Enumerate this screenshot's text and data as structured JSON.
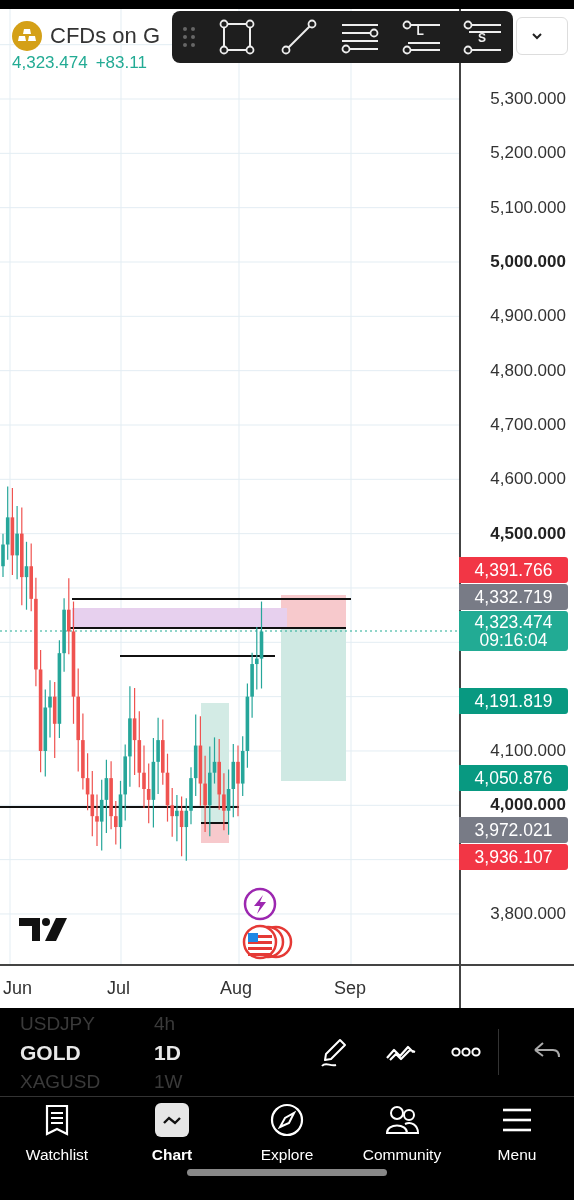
{
  "header": {
    "symbol": "CFDs on G",
    "price": "4,323.474",
    "change": "+83.11"
  },
  "drawing_toolbar": {
    "tools": [
      {
        "kind": "rectangle"
      },
      {
        "kind": "trend-line"
      },
      {
        "kind": "parallel-lines"
      },
      {
        "kind": "long-position",
        "letter": "L"
      },
      {
        "kind": "short-position",
        "letter": "S"
      }
    ]
  },
  "price_axis": {
    "ticks": [
      {
        "label": "5,300.000",
        "major": false
      },
      {
        "label": "5,200.000",
        "major": false
      },
      {
        "label": "5,100.000",
        "major": false
      },
      {
        "label": "5,000.000",
        "major": true
      },
      {
        "label": "4,900.000",
        "major": false
      },
      {
        "label": "4,800.000",
        "major": false
      },
      {
        "label": "4,700.000",
        "major": false
      },
      {
        "label": "4,600.000",
        "major": false
      },
      {
        "label": "4,500.000",
        "major": true
      },
      {
        "label": "4,100.000",
        "major": false
      },
      {
        "label": "4,000.000",
        "major": true
      },
      {
        "label": "3,800.000",
        "major": false
      }
    ],
    "badges": [
      {
        "text": "4,391.766",
        "color": "#f23645"
      },
      {
        "text": "4,332.719",
        "color": "#787b86"
      },
      {
        "text": "4,323.474",
        "countdown": "09:16:04",
        "color": "#22ab94"
      },
      {
        "text": "4,191.819",
        "color": "#089981"
      },
      {
        "text": "4,050.876",
        "color": "#089981"
      },
      {
        "text": "3,972.021",
        "color": "#787b86"
      },
      {
        "text": "3,936.107",
        "color": "#f23645"
      }
    ]
  },
  "time_axis": {
    "labels": [
      "Jun",
      "Jul",
      "Aug",
      "Sep"
    ]
  },
  "symbol_picker": [
    {
      "symbol": "USDJPY",
      "interval": "4h",
      "selected": false
    },
    {
      "symbol": "GOLD",
      "interval": "1D",
      "selected": true
    },
    {
      "symbol": "XAGUSD",
      "interval": "1W",
      "selected": false
    }
  ],
  "chart_tools": [
    {
      "kind": "draw"
    },
    {
      "kind": "patterns"
    },
    {
      "kind": "more"
    },
    {
      "kind": "undo"
    }
  ],
  "nav": [
    {
      "label": "Watchlist",
      "kind": "watchlist",
      "selected": false
    },
    {
      "label": "Chart",
      "kind": "chart",
      "selected": true
    },
    {
      "label": "Explore",
      "kind": "explore",
      "selected": false
    },
    {
      "label": "Community",
      "kind": "community",
      "selected": false
    },
    {
      "label": "Menu",
      "kind": "menu",
      "selected": false
    }
  ]
}
